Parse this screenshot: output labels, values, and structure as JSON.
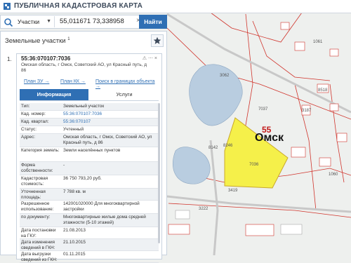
{
  "app": {
    "title": "ПУБЛИЧНАЯ КАДАСТРОВАЯ КАРТА"
  },
  "search": {
    "category": "Участки",
    "query": "55,011671 73,338958",
    "find_label": "Найти"
  },
  "panel": {
    "heading": "Земельные участки",
    "count": "1"
  },
  "result": {
    "index": "1.",
    "cad_number": "55:36:070107:7036",
    "address": "Омская область, г Омск, Советский АО, ул Красный путь, д 86",
    "links": [
      "План ЗУ →",
      "План КК →",
      "Поиск в границах объекта →"
    ]
  },
  "tabs": [
    "Информация",
    "Услуги"
  ],
  "rows": [
    {
      "k": "Тип:",
      "v": "Земельный участок"
    },
    {
      "k": "Кад. номер:",
      "v": "55:36:070107:7036",
      "link": true
    },
    {
      "k": "Кад. квартал:",
      "v": "55:36:070107",
      "link": true
    },
    {
      "k": "Статус:",
      "v": "Учтенный"
    },
    {
      "k": "Адрес:",
      "v": "Омская область, г Омск, Советский АО, ул Красный путь, д 86"
    },
    {
      "k": "Категория земель:",
      "v": "Земли населённых пунктов"
    },
    {
      "k": "Форма собственности:",
      "v": "-"
    },
    {
      "k": "Кадастровая стоимость:",
      "v": "36 750 793,20 руб."
    },
    {
      "k": "Уточненная площадь:",
      "v": "7 788 кв. м"
    },
    {
      "k": "Разрешенное использование:",
      "v": "142001020000 Для многоквартирной застройки"
    },
    {
      "k": "по документу:",
      "v": "Многоквартирные жилые дома средней этажности (5-10 этажей)"
    },
    {
      "k": "Дата постановки на ГКУ:",
      "v": "21.08.2013"
    },
    {
      "k": "Дата изменения сведений в ГКН:",
      "v": "21.10.2015"
    },
    {
      "k": "Дата выгрузки сведений из ГКН:",
      "v": "01.11.2015"
    }
  ],
  "map": {
    "labels": [
      "55",
      "Омск"
    ],
    "parcel_numbers": [
      "3062",
      "7036",
      "7037",
      "8142",
      "8246",
      "3419",
      "3222",
      "4669",
      "1061",
      "8518",
      "3187",
      "1060"
    ]
  },
  "colors": {
    "accent": "#2f6fb4",
    "parcel_fill": "#f5f04a",
    "boundary": "#d0342c",
    "water": "#b9cde0"
  }
}
